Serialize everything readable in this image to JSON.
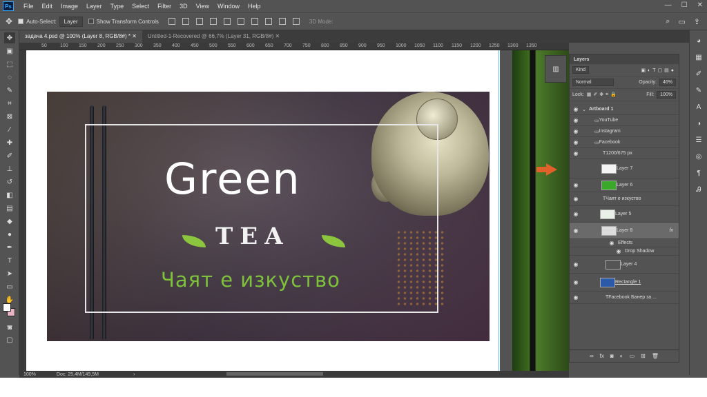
{
  "menubar": {
    "logo": "Ps",
    "items": [
      "File",
      "Edit",
      "Image",
      "Layer",
      "Type",
      "Select",
      "Filter",
      "3D",
      "View",
      "Window",
      "Help"
    ],
    "win_min": "—",
    "win_max": "☐",
    "win_close": "✕"
  },
  "options": {
    "auto_select_label": "Auto-Select:",
    "auto_select_value": "Layer",
    "transform_label": "Show Transform Controls",
    "mode_3d": "3D Mode:"
  },
  "tabs": [
    {
      "label": "задача 4.psd @ 100% (Layer 8, RGB/8#) * ✕"
    },
    {
      "label": "Untitled-1-Recovered @ 66,7% (Layer 31, RGB/8#) ✕"
    }
  ],
  "ruler": {
    "labels": [
      "50",
      "100",
      "150",
      "200",
      "250",
      "300",
      "350",
      "400",
      "450",
      "500",
      "550",
      "600",
      "650",
      "700",
      "750",
      "800",
      "850",
      "900",
      "950",
      "1000",
      "1050",
      "1100",
      "1150",
      "1200",
      "1250",
      "1300",
      "1350"
    ]
  },
  "banner": {
    "title_green": "Green",
    "title_tea": "TEA",
    "tagline": "Чаят е изкуство"
  },
  "status": {
    "zoom": "100%",
    "doc": "Doc: 25,4M/149,5M",
    "arrow": "›"
  },
  "layers_panel": {
    "tab": "Layers",
    "kind": "Kind",
    "blend": "Normal",
    "opacity_label": "Opacity:",
    "opacity_value": "46%",
    "lock_label": "Lock:",
    "fill_label": "Fill:",
    "fill_value": "100%",
    "artboard": "Artboard 1",
    "layers": [
      {
        "name": "YouTube",
        "type": "folder"
      },
      {
        "name": "Instagram",
        "type": "folder"
      },
      {
        "name": "Facebook",
        "type": "folder-open"
      },
      {
        "name": "1200/675 px",
        "type": "text"
      },
      {
        "name": "Layer 7",
        "type": "image"
      },
      {
        "name": "Layer 6",
        "type": "image"
      },
      {
        "name": "Чаят е изкуство",
        "type": "text"
      },
      {
        "name": "Layer 5",
        "type": "image"
      },
      {
        "name": "Layer 8",
        "type": "image-selected"
      },
      {
        "name": "Effects",
        "type": "effects"
      },
      {
        "name": "Drop Shadow",
        "type": "effect"
      },
      {
        "name": "Layer 4",
        "type": "image"
      },
      {
        "name": "Rectangle 1",
        "type": "shape"
      },
      {
        "name": "Facebook Банер за ...",
        "type": "text"
      }
    ],
    "fx": "fx"
  },
  "colors": {
    "accent_arrow": "#e0612a",
    "tagline": "#7ec13b",
    "guide": "#5ac8f0"
  }
}
